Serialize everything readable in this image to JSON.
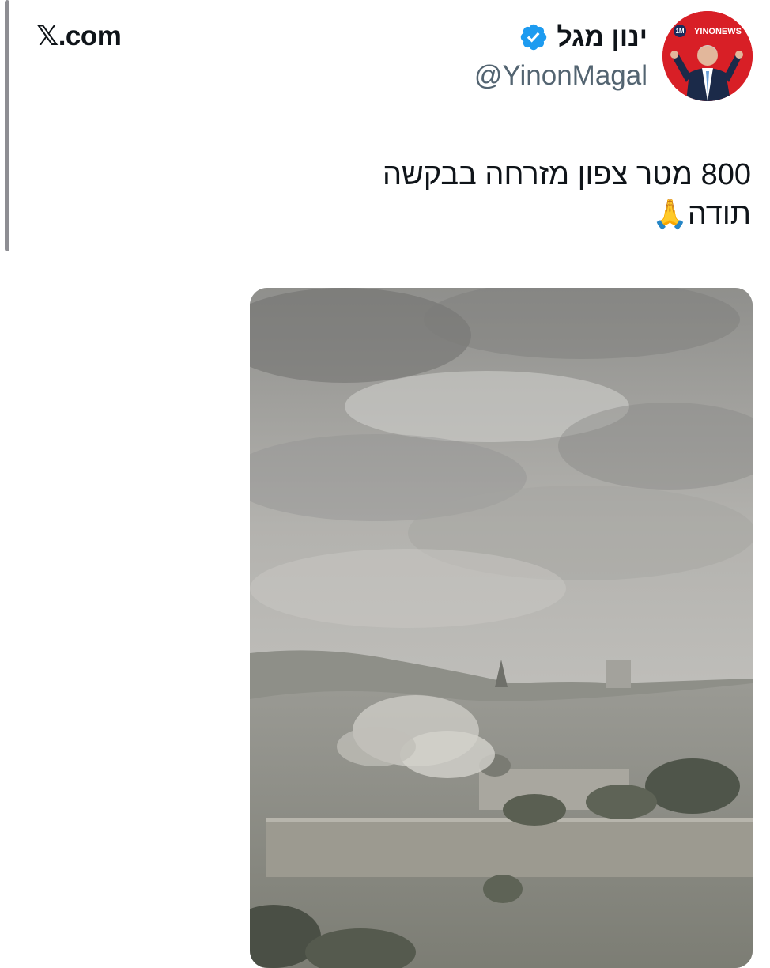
{
  "site": {
    "label": "𝕏.com"
  },
  "author": {
    "name": "ינון מגל",
    "handle": "@YinonMagal",
    "avatar_badge": "YINONEWS",
    "avatar_subbadge": "1M",
    "verified_icon": "verified-badge-icon",
    "verified_color": "#1d9bf0"
  },
  "tweet": {
    "line1": "800 מטר צפון מזרחה בבקשה",
    "line2": "תודה",
    "emoji": "🙏"
  },
  "media": {
    "type": "video-frame"
  },
  "colors": {
    "accent": "#1d9bf0",
    "avatar_bg": "#d81f26",
    "handle_gray": "#536471"
  }
}
